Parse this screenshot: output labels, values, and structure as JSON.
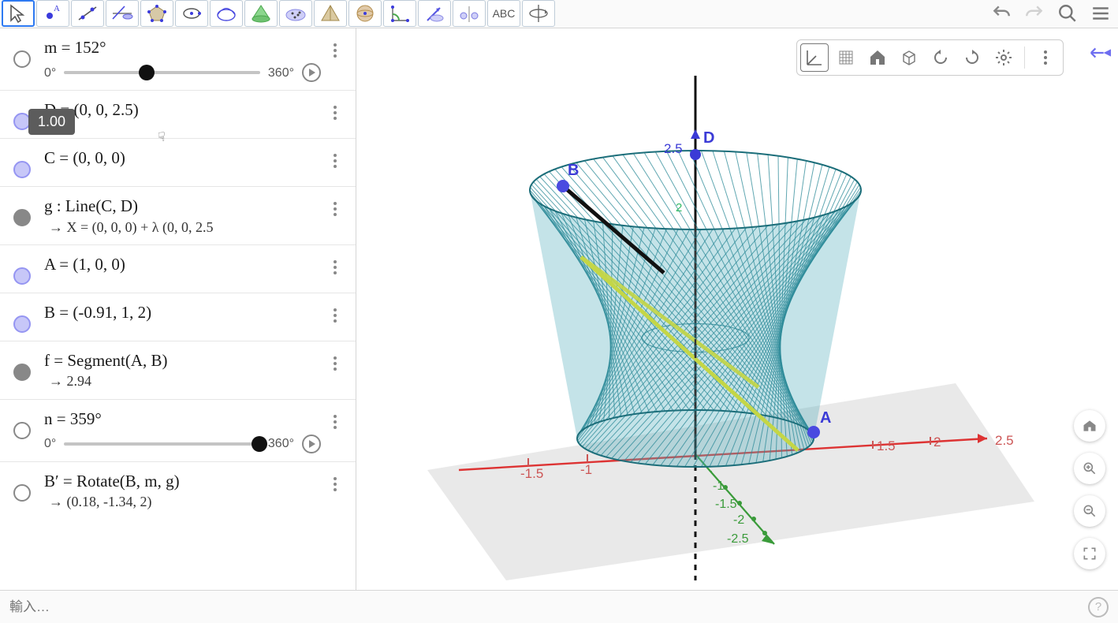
{
  "toolbar_tools": [
    "move",
    "point",
    "line",
    "perpendicular",
    "polygon",
    "circle",
    "ellipse",
    "cone",
    "dotcloud",
    "tetrahedron",
    "sphere",
    "angle",
    "vector",
    "mirror",
    "text",
    "rotateview"
  ],
  "toolbar_text_label": "ABC",
  "undo_label": "↶",
  "redo_label": "↷",
  "search_label": "🔍",
  "menu_label": "≡",
  "tooltip_value": "1.00",
  "algebra": [
    {
      "id": "m",
      "circle": "empty",
      "expr": "m = 152°",
      "slider": {
        "min": "0°",
        "max": "360°",
        "pos": 0.423,
        "play": true
      }
    },
    {
      "id": "D",
      "circle": "lightblue",
      "expr": "D = (0, 0, 2.5)"
    },
    {
      "id": "C",
      "circle": "lightblue",
      "expr": "C = (0, 0, 0)"
    },
    {
      "id": "g",
      "circle": "gray",
      "expr": "g : Line(C, D)",
      "sub": "→ X = (0, 0, 0) + λ (0, 0, 2.5"
    },
    {
      "id": "A",
      "circle": "lightblue",
      "expr": "A = (1, 0, 0)"
    },
    {
      "id": "B",
      "circle": "lightblue",
      "expr": "B = (-0.91, 1, 2)"
    },
    {
      "id": "f",
      "circle": "gray",
      "expr": "f = Segment(A, B)",
      "sub": "→ 2.94"
    },
    {
      "id": "n",
      "circle": "empty",
      "expr": "n = 359°",
      "slider": {
        "min": "0°",
        "max": "360°",
        "pos": 0.997,
        "play": true
      }
    },
    {
      "id": "Bp",
      "circle": "empty",
      "expr": "B′ = Rotate(B, m, g)",
      "sub": "→ (0.18, -1.34, 2)"
    }
  ],
  "gfx_strip": [
    "axes",
    "grid",
    "home",
    "cube",
    "rotate-ccw",
    "rotate-cw",
    "settings",
    "more"
  ],
  "view": {
    "points": {
      "A": "A",
      "B": "B",
      "D": "D"
    },
    "z_label_2_5": "2.5",
    "z_tick_2": "2",
    "x_ticks": [
      "-1.5",
      "-1",
      "1.5",
      "2",
      "2.5"
    ],
    "y_ticks": [
      "-1",
      "-1.5",
      "-2",
      "-2.5"
    ]
  },
  "float_buttons": [
    "home",
    "zoom-in",
    "zoom-out",
    "fullscreen"
  ],
  "input_placeholder": "輸入…",
  "help_label": "?"
}
